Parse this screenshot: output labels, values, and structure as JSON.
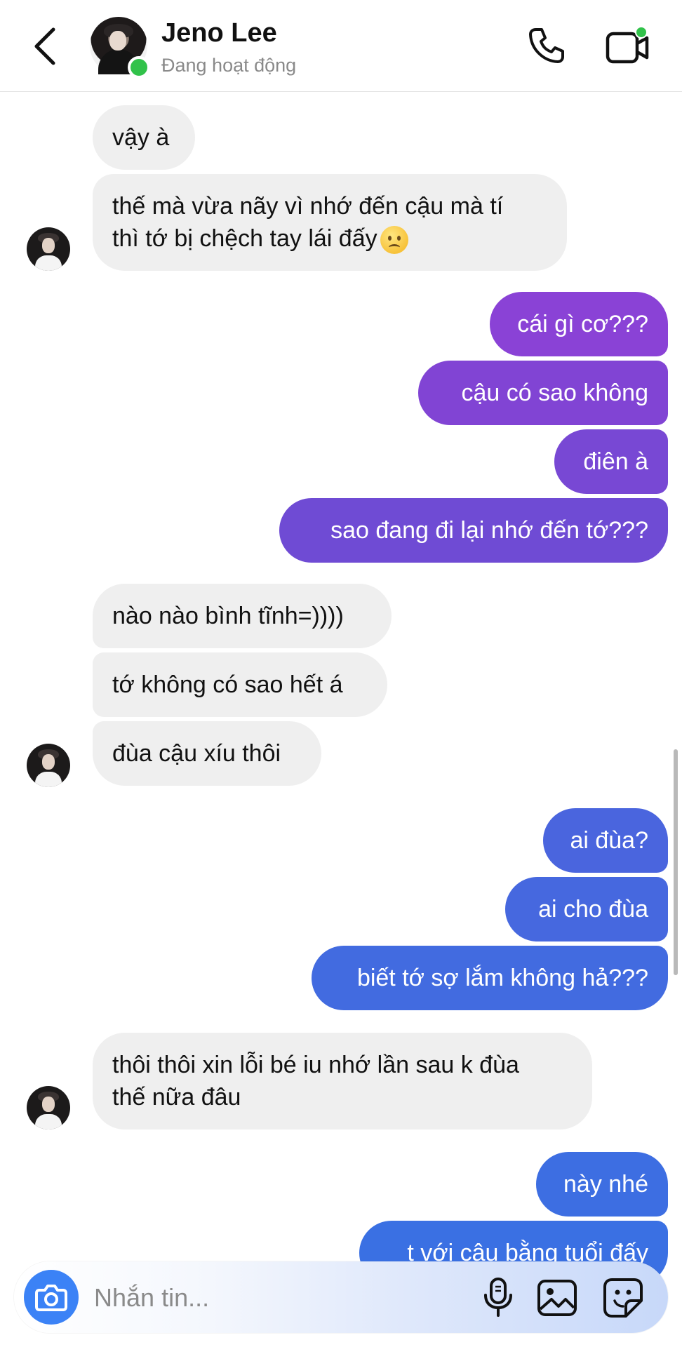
{
  "header": {
    "contact_name": "Jeno Lee",
    "status": "Đang hoạt động"
  },
  "messages": [
    {
      "side": "in",
      "text": "vậy à"
    },
    {
      "side": "in",
      "text": "thế mà vừa nãy vì nhớ đến cậu mà tí\nthì tớ bị chệch tay lái đấy",
      "emoji": "worried-face-emoji"
    },
    {
      "side": "out",
      "text": "cái gì cơ???"
    },
    {
      "side": "out",
      "text": "cậu có sao không"
    },
    {
      "side": "out",
      "text": "điên à"
    },
    {
      "side": "out",
      "text": "sao đang đi lại nhớ đến tớ???"
    },
    {
      "side": "in",
      "text": "nào nào bình tĩnh=))))"
    },
    {
      "side": "in",
      "text": "tớ không có sao hết á"
    },
    {
      "side": "in",
      "text": "đùa cậu xíu thôi"
    },
    {
      "side": "out",
      "text": "ai đùa?"
    },
    {
      "side": "out",
      "text": "ai cho đùa"
    },
    {
      "side": "out",
      "text": "biết tớ sợ lắm không hả???"
    },
    {
      "side": "in",
      "text": "thôi thôi xin lỗi bé iu nhớ lần sau k đùa\nthế nữa đâu"
    },
    {
      "side": "out",
      "text": "này nhé"
    },
    {
      "side": "out",
      "text": "t với cậu bằng tuổi đấy"
    }
  ],
  "composer": {
    "placeholder": "Nhắn tin..."
  },
  "colors": {
    "incoming_bubble": "#efefef",
    "outgoing_purple": "#7a3fd2",
    "outgoing_blue": "#3f6fe2",
    "online": "#31c24a",
    "camera_button": "#3b82f6"
  },
  "icons": [
    "back-arrow-icon",
    "phone-icon",
    "video-camera-icon",
    "camera-icon",
    "microphone-icon",
    "gallery-icon",
    "sticker-icon"
  ]
}
